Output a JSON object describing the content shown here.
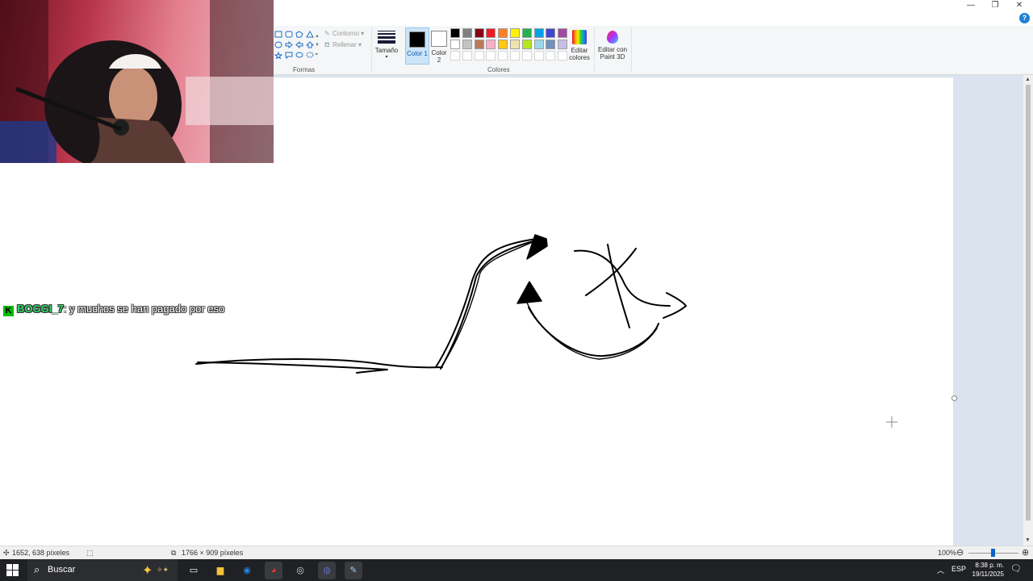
{
  "window": {
    "minimize_glyph": "—",
    "maximize_glyph": "❐",
    "close_glyph": "✕",
    "help_glyph": "?"
  },
  "ribbon": {
    "shapes_group_label": "Formas",
    "outline_label": "Contorno",
    "fill_label": "Rellenar",
    "size_label": "Tamaño",
    "color1_label": "Color 1",
    "color1_value": "#000000",
    "color2_label": "Color 2",
    "color2_value": "#ffffff",
    "colors_group_label": "Colores",
    "edit_colors_label": "Editar colores",
    "paint3d_label": "Editar con Paint 3D",
    "palette_row1": [
      "#000000",
      "#7f7f7f",
      "#880015",
      "#ed1c24",
      "#ff7f27",
      "#fff200",
      "#22b14c",
      "#00a2e8",
      "#3f48cc",
      "#a349a4"
    ],
    "palette_row2": [
      "#ffffff",
      "#c3c3c3",
      "#b97a57",
      "#ffaec9",
      "#ffc90e",
      "#efe4b0",
      "#b5e61d",
      "#99d9ea",
      "#7092be",
      "#c8bfe7"
    ]
  },
  "chat": {
    "badge": "K",
    "username": "BOGGI_7",
    "message": ": y muchos se han pagado por eso"
  },
  "statusbar": {
    "cursor_position": "1652, 638 píxeles",
    "canvas_size": "1766 × 909 píxeles",
    "zoom": "100%",
    "zoom_fraction": 0.5
  },
  "taskbar": {
    "search_label": "Buscar",
    "language": "ESP",
    "time": "8:38 p. m.",
    "date": "19/11/2025"
  }
}
